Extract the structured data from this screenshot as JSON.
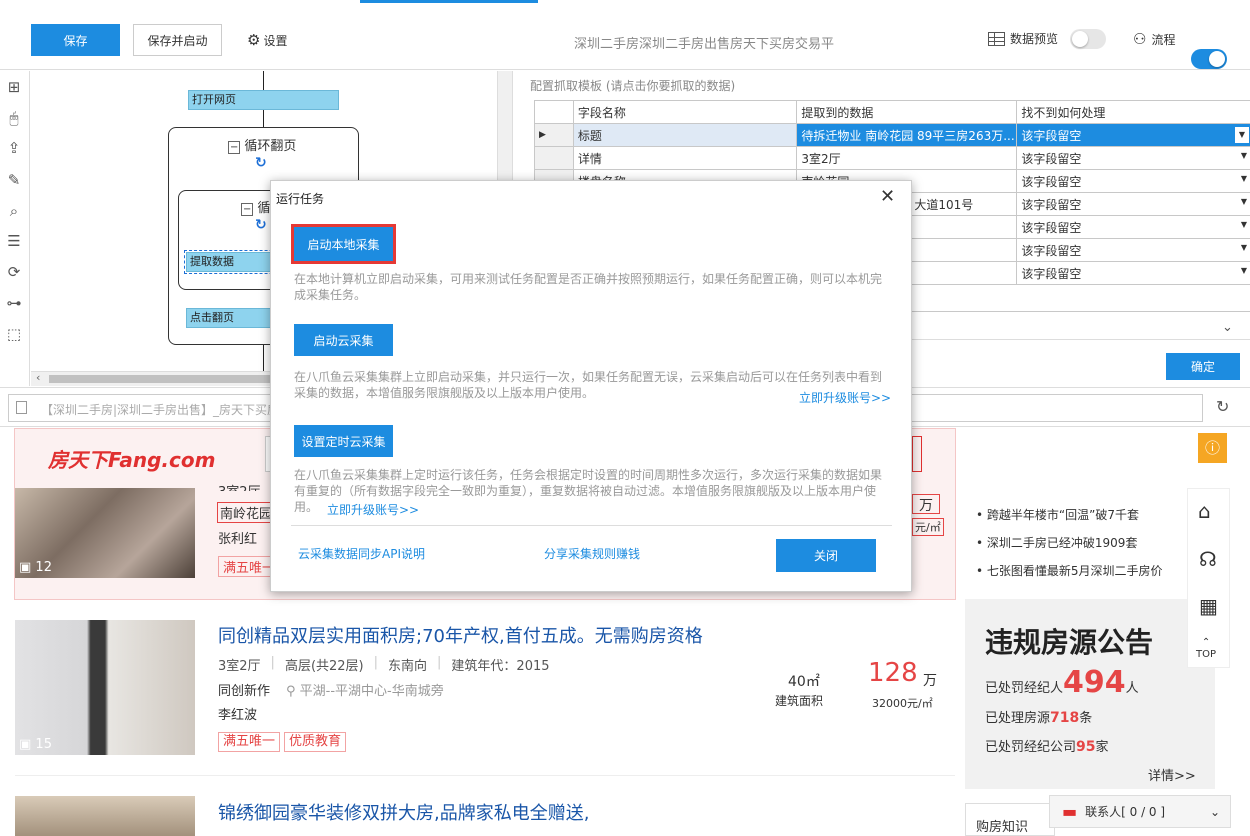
{
  "toolbar": {
    "save": "保存",
    "save_start": "保存并启动",
    "settings": "设置",
    "page_title": "深圳二手房深圳二手房出售房天下买房交易平",
    "data_preview": "数据预览",
    "flow": "流程"
  },
  "flow": {
    "open_page": "打开网页",
    "loop_page": "循环翻页",
    "loop_inner": "循环",
    "extract": "提取数据",
    "click_next": "点击翻页"
  },
  "config": {
    "title": "配置抓取模板 (请点击你要抓取的数据)",
    "headers": [
      "字段名称",
      "提取到的数据",
      "找不到如何处理"
    ],
    "rows": [
      {
        "name": "标题",
        "value": "待拆迁物业 南岭花园 89平三房263万...",
        "action": "该字段留空"
      },
      {
        "name": "详情",
        "value": "3室2厅",
        "action": "该字段留空"
      },
      {
        "name": "楼盘名称",
        "value": "南岭花园",
        "action": "该字段留空"
      },
      {
        "name": "",
        "value": "大道101号",
        "action": "该字段留空"
      },
      {
        "name": "",
        "value": "",
        "action": "该字段留空"
      },
      {
        "name": "",
        "value": "",
        "action": "该字段留空"
      },
      {
        "name": "",
        "value": "",
        "action": "该字段留空"
      }
    ],
    "confirm": "确定"
  },
  "url_bar": {
    "text": "【深圳二手房|深圳二手房出售】_房天下买房"
  },
  "modal": {
    "title": "运行任务",
    "local_btn": "启动本地采集",
    "local_desc": "在本地计算机立即启动采集，可用来测试任务配置是否正确并按照预期运行，如果任务配置正确，则可以本机完成采集任务。",
    "cloud_btn": "启动云采集",
    "cloud_desc": "在八爪鱼云采集集群上立即启动采集，并只运行一次，如果任务配置无误，云采集启动后可以在任务列表中看到采集的数据，本增值服务限旗舰版及以上版本用户使用。",
    "upgrade1": "立即升级账号>>",
    "timer_btn": "设置定时云采集",
    "timer_desc": "在八爪鱼云采集集群上定时运行该任务，任务会根据定时设置的时间周期性多次运行，多次运行采集的数据如果有重复的（所有数据字段完全一致即为重复），重复数据将被自动过滤。本增值服务限旗舰版及以上版本用户使用。",
    "upgrade2": "立即升级账号>>",
    "api_link": "云采集数据同步API说明",
    "share_link": "分享采集规则赚钱",
    "close": "关闭"
  },
  "site": {
    "logo": "房天下Fang.com",
    "listing1": {
      "detail": "3室2厅",
      "estate": "南岭花园",
      "agent": "张利红",
      "tag": "满五唯一",
      "photos": "12",
      "price_unit": "万",
      "unit_price": "元/㎡"
    },
    "listing2": {
      "title": "同创精品双层实用面积房;70年产权,首付五成。无需购房资格",
      "rooms": "3室2厅",
      "floor": "高层(共22层)",
      "direction": "东南向",
      "year": "建筑年代：2015",
      "estate": "同创新作",
      "location": "平湖--平湖中心-华南城旁",
      "agent": "李红波",
      "tags": [
        "满五唯一",
        "优质教育"
      ],
      "photos": "15",
      "area": "40㎡",
      "area_label": "建筑面积",
      "price": "128",
      "price_unit": "万",
      "unit_price": "32000元/㎡"
    },
    "listing3": {
      "title": "锦绣御园豪华装修双拼大房,品牌家私电全赠送,"
    },
    "news": [
      "跨越半年楼市“回温”破7千套",
      "深圳二手房已经冲破1909套",
      "七张图看懂最新5月深圳二手房价"
    ],
    "notice": {
      "title": "违规房源公告",
      "l1a": "已处罚经纪人",
      "l1n": "494",
      "l1b": "人",
      "l2a": "已处理房源",
      "l2n": "718",
      "l2b": "条",
      "l3a": "已处罚经纪公司",
      "l3n": "95",
      "l3b": "家",
      "more": "详情>>"
    },
    "knowledge": "购房知识",
    "top": "TOP",
    "contact": "联系人[ 0 / 0 ]"
  },
  "colors": {
    "accent": "#1d8ce0",
    "brand_red": "#e54545"
  }
}
